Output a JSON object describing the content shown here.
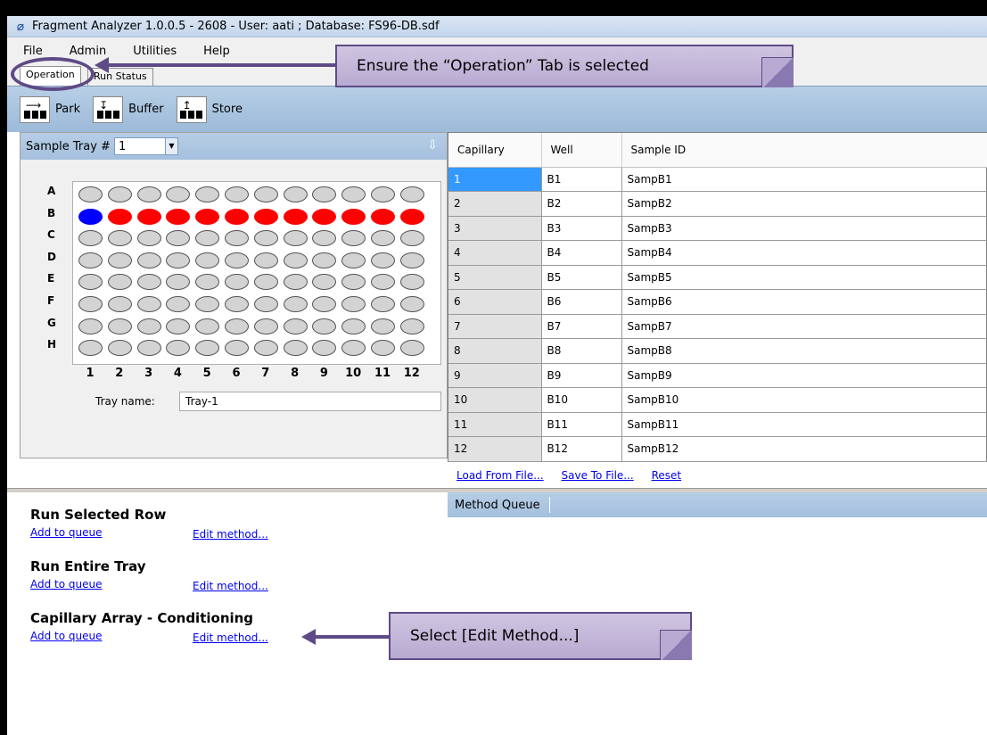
{
  "window": {
    "title": "Fragment Analyzer 1.0.0.5 - 2608 - User: aati ; Database: FS96-DB.sdf"
  },
  "menu": [
    "File",
    "Admin",
    "Utilities",
    "Help"
  ],
  "tabs": [
    {
      "label": "Operation",
      "active": true
    },
    {
      "label": "Run Status",
      "active": false
    }
  ],
  "toolbar": {
    "park_label": "Park",
    "buffer_label": "Buffer",
    "store_label": "Store"
  },
  "tray": {
    "header_label": "Sample Tray #",
    "selected_number": "1",
    "rows": [
      "A",
      "B",
      "C",
      "D",
      "E",
      "F",
      "G",
      "H"
    ],
    "columns": [
      "1",
      "2",
      "3",
      "4",
      "5",
      "6",
      "7",
      "8",
      "9",
      "10",
      "11",
      "12"
    ],
    "tray_name_label": "Tray name:",
    "tray_name_value": "Tray-1",
    "highlighted_row": "B",
    "well_colors": {
      "empty": "#d3d3d3",
      "selected": "#0000ff",
      "queued": "#ff0000"
    }
  },
  "table": {
    "headers": [
      "Capillary",
      "Well",
      "Sample ID"
    ],
    "rows": [
      [
        "1",
        "B1",
        "SampB1"
      ],
      [
        "2",
        "B2",
        "SampB2"
      ],
      [
        "3",
        "B3",
        "SampB3"
      ],
      [
        "4",
        "B4",
        "SampB4"
      ],
      [
        "5",
        "B5",
        "SampB5"
      ],
      [
        "6",
        "B6",
        "SampB6"
      ],
      [
        "7",
        "B7",
        "SampB7"
      ],
      [
        "8",
        "B8",
        "SampB8"
      ],
      [
        "9",
        "B9",
        "SampB9"
      ],
      [
        "10",
        "B10",
        "SampB10"
      ],
      [
        "11",
        "B11",
        "SampB11"
      ],
      [
        "12",
        "B12",
        "SampB12"
      ]
    ],
    "links": {
      "load": "Load From File...",
      "save": "Save To File...",
      "reset": "Reset"
    }
  },
  "actions": {
    "selected_row": {
      "title": "Run Selected Row",
      "add": "Add to queue",
      "edit": "Edit method..."
    },
    "entire_tray": {
      "title": "Run Entire Tray",
      "add": "Add to queue",
      "edit": "Edit method..."
    },
    "conditioning": {
      "title": "Capillary Array - Conditioning",
      "add": "Add to queue",
      "edit": "Edit method..."
    }
  },
  "queue": {
    "header": "Method Queue"
  },
  "callouts": {
    "operation_tab": "Ensure the “Operation” Tab is selected",
    "edit_method": "Select [Edit Method...]"
  }
}
